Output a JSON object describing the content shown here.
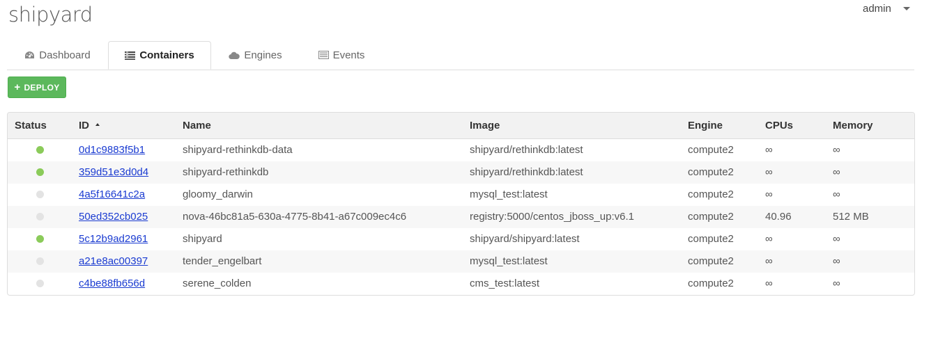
{
  "brand": {
    "logo": "shipyard"
  },
  "user_menu": {
    "name": "admin"
  },
  "tabs": [
    {
      "label": "Dashboard",
      "icon": "dashboard-gauge-icon",
      "active": false
    },
    {
      "label": "Containers",
      "icon": "containers-list-icon",
      "active": true
    },
    {
      "label": "Engines",
      "icon": "cloud-icon",
      "active": false
    },
    {
      "label": "Events",
      "icon": "events-list-icon",
      "active": false
    }
  ],
  "toolbar": {
    "deploy_label": "DEPLOY",
    "deploy_icon": "plus-icon"
  },
  "colors": {
    "accent_green": "#5cb85c",
    "status_running": "#8bcb5a",
    "status_stopped": "#e3e3e3",
    "link": "#1a3bd1"
  },
  "table": {
    "columns": [
      "Status",
      "ID",
      "Name",
      "Image",
      "Engine",
      "CPUs",
      "Memory"
    ],
    "sort": {
      "column": "ID",
      "direction": "ascending"
    },
    "rows": [
      {
        "status": "running",
        "id": "0d1c9883f5b1",
        "name": "shipyard-rethinkdb-data",
        "image": "shipyard/rethinkdb:latest",
        "engine": "compute2",
        "cpus": "∞",
        "memory": "∞"
      },
      {
        "status": "running",
        "id": "359d51e3d0d4",
        "name": "shipyard-rethinkdb",
        "image": "shipyard/rethinkdb:latest",
        "engine": "compute2",
        "cpus": "∞",
        "memory": "∞"
      },
      {
        "status": "stopped",
        "id": "4a5f16641c2a",
        "name": "gloomy_darwin",
        "image": "mysql_test:latest",
        "engine": "compute2",
        "cpus": "∞",
        "memory": "∞"
      },
      {
        "status": "stopped",
        "id": "50ed352cb025",
        "name": "nova-46bc81a5-630a-4775-8b41-a67c009ec4c6",
        "image": "registry:5000/centos_jboss_up:v6.1",
        "engine": "compute2",
        "cpus": "40.96",
        "memory": "512 MB"
      },
      {
        "status": "running",
        "id": "5c12b9ad2961",
        "name": "shipyard",
        "image": "shipyard/shipyard:latest",
        "engine": "compute2",
        "cpus": "∞",
        "memory": "∞"
      },
      {
        "status": "stopped",
        "id": "a21e8ac00397",
        "name": "tender_engelbart",
        "image": "mysql_test:latest",
        "engine": "compute2",
        "cpus": "∞",
        "memory": "∞"
      },
      {
        "status": "stopped",
        "id": "c4be88fb656d",
        "name": "serene_colden",
        "image": "cms_test:latest",
        "engine": "compute2",
        "cpus": "∞",
        "memory": "∞"
      }
    ]
  }
}
